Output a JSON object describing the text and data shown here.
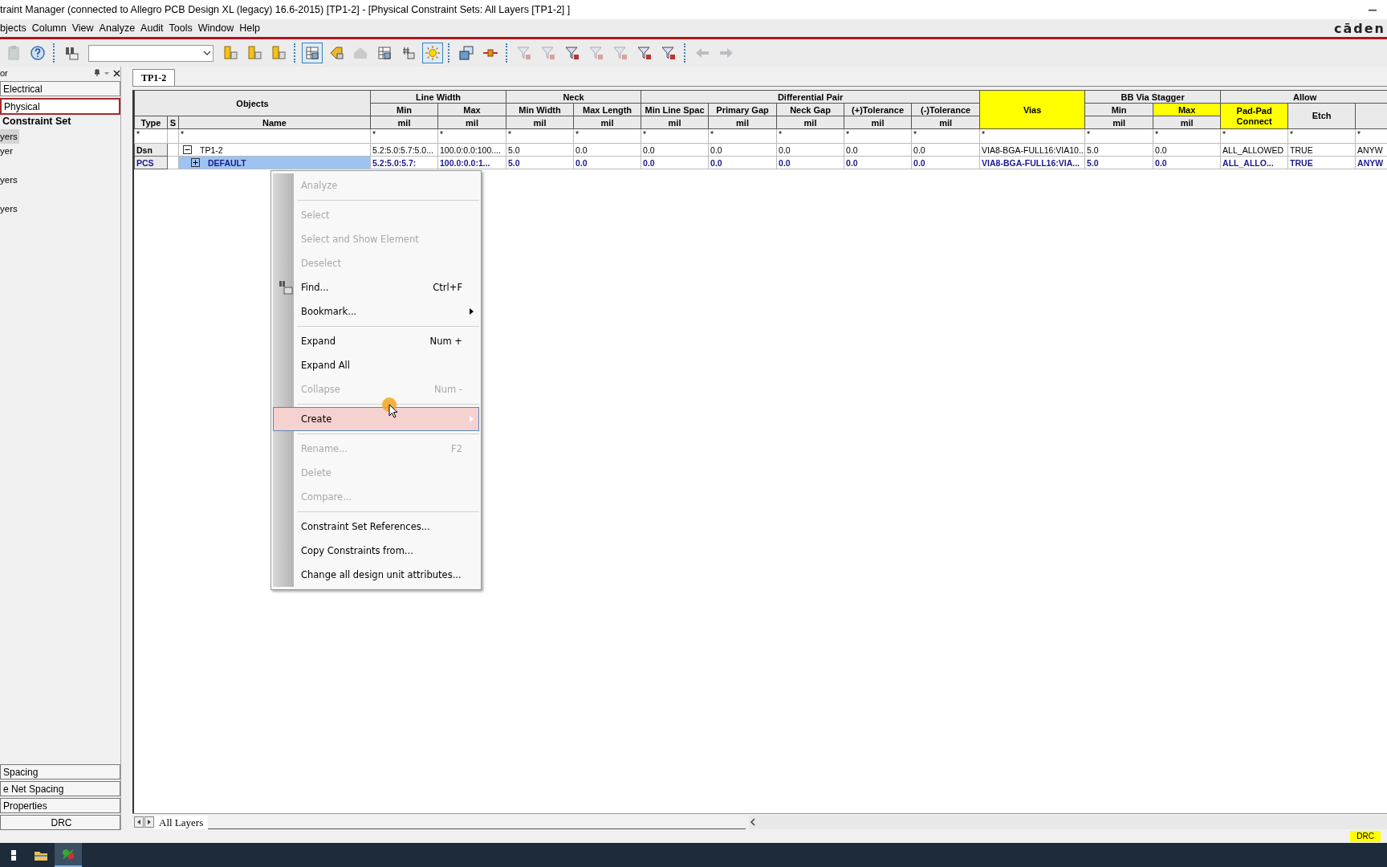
{
  "window": {
    "title": "traint Manager (connected to Allegro PCB Design XL (legacy) 16.6-2015) [TP1-2] - [Physical Constraint Sets:  All Layers [TP1-2] ]"
  },
  "menu": [
    "bjects",
    "Column",
    "View",
    "Analyze",
    "Audit",
    "Tools",
    "Window",
    "Help"
  ],
  "logo": "cāden",
  "toolbar": [
    {
      "kind": "button",
      "pressed": false,
      "disabled": true
    },
    {
      "kind": "button",
      "pressed": false,
      "disabled": false
    },
    {
      "kind": "separator"
    },
    {
      "kind": "button",
      "pressed": false,
      "disabled": false
    },
    {
      "kind": "combo"
    },
    {
      "kind": "button",
      "pressed": false,
      "disabled": false
    },
    {
      "kind": "button",
      "pressed": false,
      "disabled": false
    },
    {
      "kind": "button",
      "pressed": false,
      "disabled": false
    },
    {
      "kind": "separator"
    },
    {
      "kind": "button",
      "pressed": true,
      "disabled": false
    },
    {
      "kind": "button",
      "pressed": false,
      "disabled": false
    },
    {
      "kind": "button",
      "pressed": false,
      "disabled": true
    },
    {
      "kind": "button",
      "pressed": false,
      "disabled": false
    },
    {
      "kind": "button",
      "pressed": false,
      "disabled": false
    },
    {
      "kind": "button",
      "pressed": true,
      "disabled": false
    },
    {
      "kind": "separator"
    },
    {
      "kind": "button",
      "pressed": false,
      "disabled": false
    },
    {
      "kind": "button",
      "pressed": false,
      "disabled": false
    },
    {
      "kind": "separator"
    },
    {
      "kind": "button",
      "pressed": false,
      "disabled": true
    },
    {
      "kind": "button",
      "pressed": false,
      "disabled": true
    },
    {
      "kind": "button",
      "pressed": false,
      "disabled": false
    },
    {
      "kind": "button",
      "pressed": false,
      "disabled": true
    },
    {
      "kind": "button",
      "pressed": false,
      "disabled": true
    },
    {
      "kind": "button",
      "pressed": false,
      "disabled": false
    },
    {
      "kind": "button",
      "pressed": false,
      "disabled": false
    },
    {
      "kind": "separator"
    },
    {
      "kind": "button",
      "pressed": false,
      "disabled": true
    },
    {
      "kind": "button",
      "pressed": false,
      "disabled": true
    }
  ],
  "sidebar": {
    "title": "or",
    "sections": [
      {
        "label": "Electrical",
        "selected": false
      },
      {
        "label": "Physical",
        "selected": true
      }
    ],
    "tree": [
      {
        "label": "Constraint Set",
        "children": [
          {
            "label": "yers",
            "selected": true
          },
          {
            "label": "yer",
            "selected": false
          },
          {
            "label": "yers",
            "selected": false
          },
          {
            "label": "yers",
            "selected": false
          }
        ]
      }
    ],
    "bottom_sections": [
      {
        "label": "Spacing"
      },
      {
        "label": "e Net Spacing"
      },
      {
        "label": "Properties"
      },
      {
        "label": "DRC"
      }
    ]
  },
  "tabs": [
    {
      "label": "TP1-2",
      "selected": true
    }
  ],
  "table": {
    "column_groups": [
      {
        "kind": "objects",
        "label": "Objects",
        "columns": [
          {
            "label": "Type"
          },
          {
            "label": "S"
          },
          {
            "label": "Name"
          }
        ]
      },
      {
        "kind": "group",
        "label": "Line Width",
        "columns": [
          {
            "label": "Min",
            "unit": "mil",
            "highlighted": false
          },
          {
            "label": "Max",
            "unit": "mil",
            "highlighted": false
          }
        ]
      },
      {
        "kind": "group",
        "label": "Neck",
        "columns": [
          {
            "label": "Min Width",
            "unit": "mil",
            "highlighted": false
          },
          {
            "label": "Max Length",
            "unit": "mil",
            "highlighted": false
          }
        ]
      },
      {
        "kind": "group",
        "label": "Differential Pair",
        "columns": [
          {
            "label": "Min Line Spac",
            "unit": "mil",
            "highlighted": false
          },
          {
            "label": "Primary Gap",
            "unit": "mil",
            "highlighted": false
          },
          {
            "label": "Neck Gap",
            "unit": "mil",
            "highlighted": false
          },
          {
            "label": "(+)Tolerance",
            "unit": "mil",
            "highlighted": false
          },
          {
            "label": "(-)Tolerance",
            "unit": "mil",
            "highlighted": false
          }
        ]
      },
      {
        "kind": "single",
        "label": "Vias",
        "highlighted": true
      },
      {
        "kind": "group",
        "label": "BB Via Stagger",
        "columns": [
          {
            "label": "Min",
            "unit": "mil",
            "highlighted": false
          },
          {
            "label": "Max",
            "unit": "mil",
            "highlighted": true
          }
        ]
      },
      {
        "kind": "group",
        "label": "Allow",
        "columns": [
          {
            "label": "Pad-Pad Connect",
            "highlighted": true
          },
          {
            "label": "Etch",
            "highlighted": false
          },
          {
            "highlighted": false
          }
        ]
      }
    ],
    "filter_row": {
      "type": "*",
      "name": "*",
      "cells": [
        "*",
        "*",
        "*",
        "*",
        "*",
        "*",
        "*",
        "*",
        "*",
        "*",
        "*",
        "*",
        "*",
        "*",
        "*"
      ]
    },
    "rows": [
      {
        "type": "Dsn",
        "name": "TP1-2",
        "expanded": true,
        "selected": false,
        "cells": [
          "5.2:5.0:5.7:5.0...",
          "100.0:0.0:100....",
          "5.0",
          "0.0",
          "0.0",
          "0.0",
          "0.0",
          "0.0",
          "0.0",
          "VIA8-BGA-FULL16:VIA10...",
          "5.0",
          "0.0",
          "ALL_ALLOWED",
          "TRUE",
          "ANYW"
        ],
        "children": [
          {
            "type": "PCS",
            "name": "DEFAULT",
            "expanded": false,
            "selected": true,
            "cells": [
              "5.2:5.0:5.7:",
              "100.0:0.0:1...",
              "5.0",
              "0.0",
              "0.0",
              "0.0",
              "0.0",
              "0.0",
              "0.0",
              "VIA8-BGA-FULL16:VIA...",
              "5.0",
              "0.0",
              "ALL_ALLO...",
              "TRUE",
              "ANYW"
            ]
          }
        ]
      }
    ]
  },
  "sheet_tabs": [
    {
      "label": "All Layers",
      "selected": true
    }
  ],
  "context_menu": [
    {
      "kind": "item",
      "label": "Analyze",
      "disabled": true,
      "submenu": false,
      "selected": false
    },
    {
      "kind": "separator"
    },
    {
      "kind": "item",
      "label": "Select",
      "disabled": true,
      "submenu": false,
      "selected": false
    },
    {
      "kind": "item",
      "label": "Select and Show Element",
      "disabled": true,
      "submenu": false,
      "selected": false
    },
    {
      "kind": "item",
      "label": "Deselect",
      "disabled": true,
      "submenu": false,
      "selected": false
    },
    {
      "kind": "icon_item",
      "label": "Find...",
      "shortcut": "Ctrl+F",
      "disabled": false,
      "submenu": false,
      "selected": false
    },
    {
      "kind": "item",
      "label": "Bookmark...",
      "disabled": false,
      "submenu": true,
      "selected": false
    },
    {
      "kind": "separator"
    },
    {
      "kind": "item",
      "label": "Expand",
      "shortcut": "Num +",
      "disabled": false,
      "submenu": false,
      "selected": false
    },
    {
      "kind": "item",
      "label": "Expand All",
      "disabled": false,
      "submenu": false,
      "selected": false
    },
    {
      "kind": "item",
      "label": "Collapse",
      "shortcut": "Num -",
      "disabled": true,
      "submenu": false,
      "selected": false
    },
    {
      "kind": "separator"
    },
    {
      "kind": "item",
      "label": "Create",
      "disabled": false,
      "submenu": true,
      "selected": true
    },
    {
      "kind": "separator"
    },
    {
      "kind": "item",
      "label": "Rename...",
      "shortcut": "F2",
      "disabled": true,
      "submenu": false,
      "selected": false
    },
    {
      "kind": "item",
      "label": "Delete",
      "disabled": true,
      "submenu": false,
      "selected": false
    },
    {
      "kind": "item",
      "label": "Compare...",
      "disabled": true,
      "submenu": false,
      "selected": false
    },
    {
      "kind": "separator"
    },
    {
      "kind": "item",
      "label": "Constraint Set References...",
      "disabled": false,
      "submenu": false,
      "selected": false
    },
    {
      "kind": "item",
      "label": "Copy Constraints from...",
      "disabled": false,
      "submenu": false,
      "selected": false
    },
    {
      "kind": "item",
      "label": "Change all design unit attributes...",
      "disabled": false,
      "submenu": false,
      "selected": false
    }
  ],
  "status_bar": {
    "indicator": "DRC"
  },
  "taskbar": [
    {
      "active": false
    },
    {
      "active": false
    },
    {
      "active": true
    }
  ]
}
